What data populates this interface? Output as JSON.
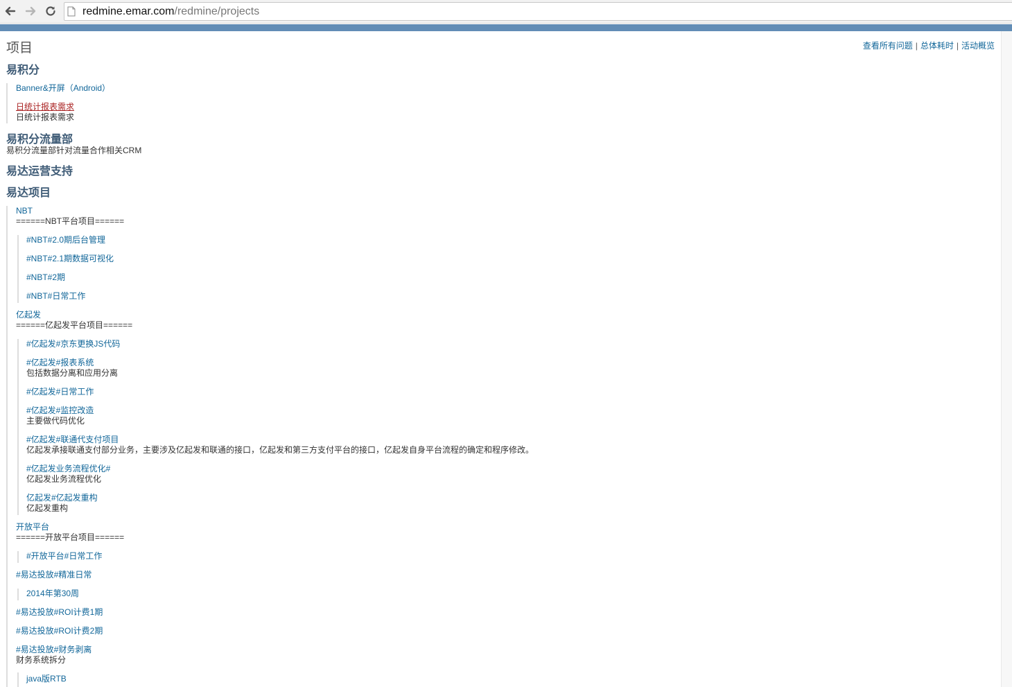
{
  "browser": {
    "url_host": "redmine.emar.com",
    "url_path": "/redmine/projects"
  },
  "page": {
    "title": "项目",
    "context_links": [
      "查看所有问题",
      "总体耗时",
      "活动概览"
    ],
    "separator": "|"
  },
  "projects": {
    "yijifen": {
      "name": "易积分",
      "children": [
        {
          "name": "Banner&开屏（Android）"
        },
        {
          "name": "日统计报表需求",
          "description": "日统计报表需求"
        }
      ]
    },
    "yijifen_liuliang": {
      "name": "易积分流量部",
      "description": "易积分流量部针对流量合作相关CRM"
    },
    "yida_yunying": {
      "name": "易达运营支持"
    },
    "yida_xiangmu": {
      "name": "易达项目",
      "nbt": {
        "name": "NBT",
        "description": "======NBT平台项目======",
        "children": [
          "#NBT#2.0期后台管理",
          "#NBT#2.1期数据可视化",
          "#NBT#2期",
          "#NBT#日常工作"
        ]
      },
      "yiqifa": {
        "name": "亿起发",
        "description": "======亿起发平台项目======",
        "children": [
          {
            "name": "#亿起发#京东更换JS代码",
            "description": ""
          },
          {
            "name": "#亿起发#报表系统",
            "description": "包括数据分离和应用分离"
          },
          {
            "name": "#亿起发#日常工作",
            "description": ""
          },
          {
            "name": "#亿起发#监控改造",
            "description": "主要做代码优化"
          },
          {
            "name": "#亿起发#联通代支付项目",
            "description": "亿起发承接联通支付部分业务，主要涉及亿起发和联通的接口，亿起发和第三方支付平台的接口，亿起发自身平台流程的确定和程序修改。"
          },
          {
            "name": "#亿起发业务流程优化#",
            "description": "亿起发业务流程优化"
          },
          {
            "name": "亿起发#亿起发重构",
            "description": "亿起发重构"
          }
        ]
      },
      "kaifang": {
        "name": "开放平台",
        "description": "======开放平台项目======",
        "children": [
          "#开放平台#日常工作"
        ]
      },
      "jingzhun": {
        "name": "#易达投放#精准日常",
        "children": [
          "2014年第30周"
        ]
      },
      "roi1": {
        "name": "#易达投放#ROI计费1期"
      },
      "roi2": {
        "name": "#易达投放#ROI计费2期"
      },
      "caiwu": {
        "name": "#易达投放#财务剥离",
        "description": "财务系统拆分",
        "children": [
          "java版RTB"
        ]
      }
    }
  }
}
